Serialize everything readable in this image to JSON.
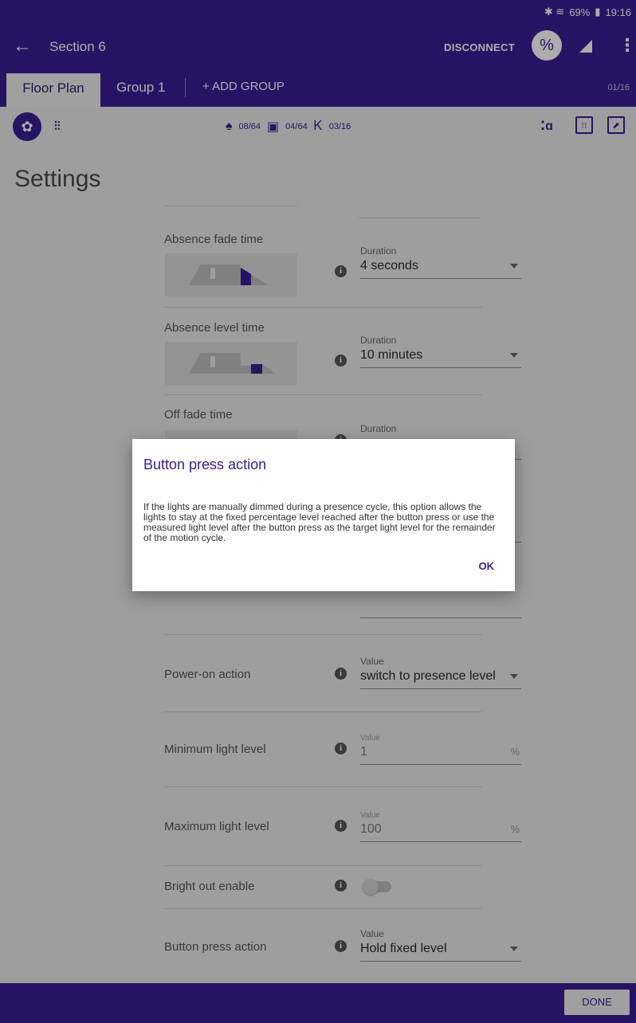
{
  "status": {
    "icons": "✱ ≋",
    "battery": "69%",
    "time": "19:16"
  },
  "appbar": {
    "back_icon": "←",
    "title": "Section 6",
    "disconnect": "DISCONNECT",
    "link_icon": "%",
    "menu_icon": "⋮"
  },
  "tabs": {
    "floor_plan": "Floor Plan",
    "group1": "Group 1",
    "add_group": "+ ADD GROUP",
    "count": "01/16"
  },
  "toolbar": {
    "settings_icon": "✿",
    "sliders_icon": "⫶⫶",
    "lights": "08/64",
    "sensors": "04/64",
    "remotes": "03/16"
  },
  "page": {
    "title": "Settings"
  },
  "settings": {
    "absence_fade": {
      "label": "Absence fade time",
      "field_label": "Duration",
      "value": "4 seconds"
    },
    "absence_level": {
      "label": "Absence level time",
      "field_label": "Duration",
      "value": "10 minutes"
    },
    "off_fade": {
      "label": "Off fade time",
      "field_label": "Duration"
    },
    "power_on": {
      "label": "Power-on action",
      "field_label": "Value",
      "value": "switch to presence level"
    },
    "min_light": {
      "label": "Minimum light level",
      "field_label": "Value",
      "value": "1",
      "unit": "%"
    },
    "max_light": {
      "label": "Maximum light level",
      "field_label": "Value",
      "value": "100",
      "unit": "%"
    },
    "bright_out": {
      "label": "Bright out enable",
      "enabled": false
    },
    "button_press": {
      "label": "Button press action",
      "field_label": "Value",
      "value": "Hold fixed level"
    }
  },
  "dialog": {
    "title": "Button press action",
    "body": "If the lights are manually dimmed during a presence cycle, this option allows the lights to stay at the fixed percentage level reached after the button press or use the measured light level after the button press as the target light level for the remainder of the motion cycle.",
    "ok": "OK"
  },
  "bottom": {
    "done": "DONE"
  },
  "colors": {
    "primary": "#3a1c92",
    "background": "#e9e9e9"
  }
}
